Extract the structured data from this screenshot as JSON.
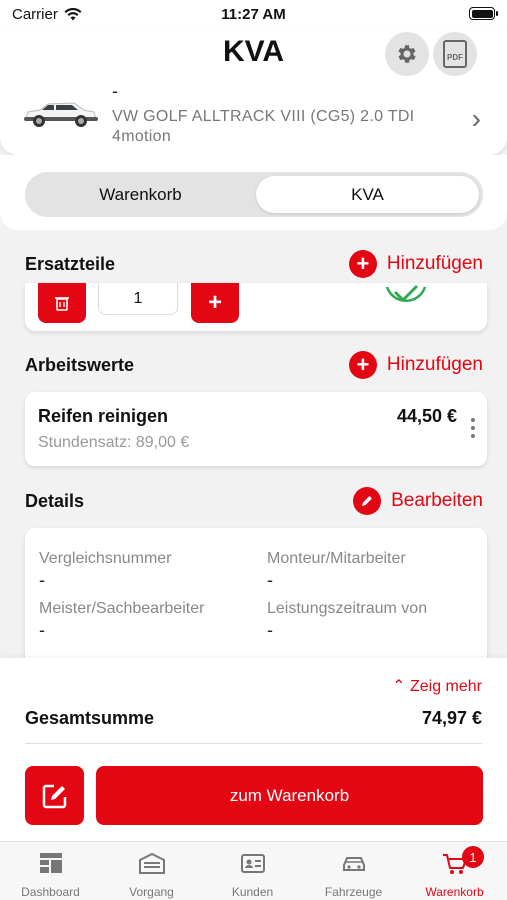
{
  "status": {
    "carrier": "Carrier",
    "time": "11:27 AM"
  },
  "header": {
    "title": "KVA",
    "vehicle_plate": "-",
    "vehicle_name": "VW GOLF ALLTRACK VIII (CG5) 2.0 TDI 4motion"
  },
  "segment": {
    "tabs": [
      "Warenkorb",
      "KVA"
    ],
    "selected": "KVA"
  },
  "spare_parts": {
    "label": "Ersatzteile",
    "add_label": "Hinzufügen",
    "quantity": "1"
  },
  "labor": {
    "label": "Arbeitswerte",
    "add_label": "Hinzufügen",
    "item_name": "Reifen reinigen",
    "item_rate": "Stundensatz: 89,00 €",
    "item_price": "44,50 €"
  },
  "details": {
    "label": "Details",
    "edit_label": "Bearbeiten",
    "fields": [
      {
        "label": "Vergleichsnummer",
        "value": "-"
      },
      {
        "label": "Monteur/Mitarbeiter",
        "value": "-"
      },
      {
        "label": "Meister/Sachbearbeiter",
        "value": "-"
      },
      {
        "label": "Leistungszeitraum von",
        "value": "-"
      }
    ]
  },
  "summary": {
    "show_more": "Zeig mehr",
    "total_label": "Gesamtsumme",
    "total_value": "74,97 €",
    "cart_button": "zum Warenkorb"
  },
  "tabbar": {
    "items": [
      "Dashboard",
      "Vorgang",
      "Kunden",
      "Fahrzeuge",
      "Warenkorb"
    ],
    "active": "Warenkorb",
    "cart_badge": "1"
  },
  "colors": {
    "accent": "#e30613",
    "background": "#f2f2f2"
  }
}
